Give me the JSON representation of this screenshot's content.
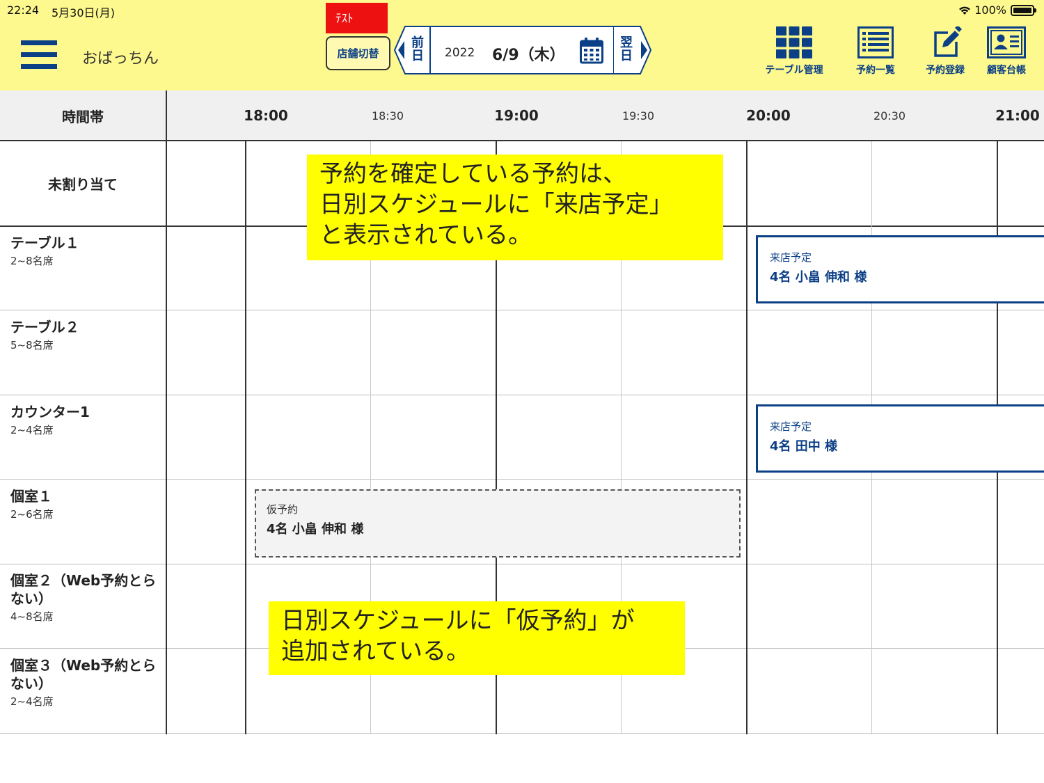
{
  "status_bar": {
    "time": "22:24",
    "date": "5月30日(月)",
    "battery": "100%"
  },
  "header": {
    "store_name": "おばっちん",
    "test_badge": "ﾃｽﾄ",
    "store_switch_label": "店舗切替",
    "prev_day": [
      "前",
      "日"
    ],
    "next_day": [
      "翌",
      "日"
    ],
    "date_year": "2022",
    "date_day": "6/9（木）",
    "actions": [
      {
        "label": "テーブル管理",
        "icon": "grid-icon"
      },
      {
        "label": "予約一覧",
        "icon": "list-icon"
      },
      {
        "label": "予約登録",
        "icon": "edit-icon"
      },
      {
        "label": "顧客台帳",
        "icon": "customer-card-icon"
      }
    ]
  },
  "schedule": {
    "time_band_title": "時間帯",
    "time_labels": [
      "18:00",
      "18:30",
      "19:00",
      "19:30",
      "20:00",
      "20:30",
      "21:00"
    ],
    "unassigned_label": "未割り当て",
    "rows": [
      {
        "name": "テーブル１",
        "seats": "2~8名席"
      },
      {
        "name": "テーブル２",
        "seats": "5~8名席"
      },
      {
        "name": "カウンター1",
        "seats": "2~4名席"
      },
      {
        "name": "個室１",
        "seats": "2~6名席"
      },
      {
        "name": "個室２（Web予約とらない）",
        "seats": "4~8名席"
      },
      {
        "name": "個室３（Web予約とらない）",
        "seats": "2~4名席"
      }
    ],
    "bookings": [
      {
        "status": "来店予定",
        "guest": "4名 小畠 伸和 様"
      },
      {
        "status": "来店予定",
        "guest": "4名 田中 様"
      },
      {
        "status": "仮予約",
        "guest": "4名 小畠 伸和 様"
      }
    ]
  },
  "annotations": {
    "top": [
      "予約を確定している予約は、",
      "日別スケジュールに「来店予定」",
      "と表示されている。"
    ],
    "bottom": [
      "日別スケジュールに「仮予約」が",
      "追加されている。"
    ]
  },
  "colors": {
    "header_bg": "#fdf98e",
    "accent": "#0b3f86",
    "test_badge": "#ee1111",
    "annotation_bg": "#ffff00"
  }
}
